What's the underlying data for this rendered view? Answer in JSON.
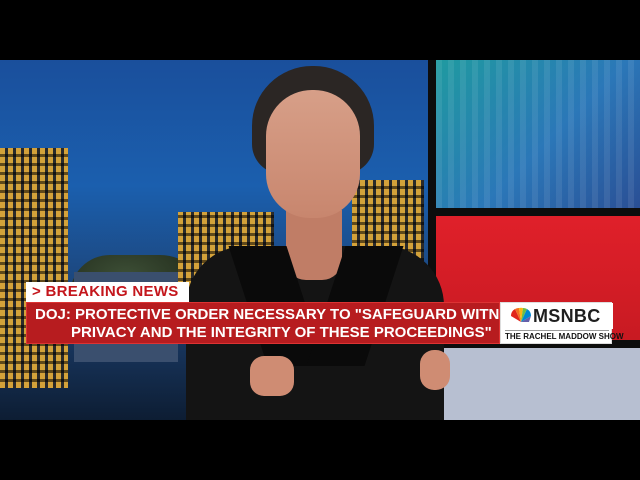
{
  "lower_third": {
    "breaking_label": "> BREAKING NEWS",
    "headline_line1": "DOJ: PROTECTIVE ORDER NECESSARY TO \"SAFEGUARD WITNESS",
    "headline_line2": "PRIVACY AND THE INTEGRITY OF THESE PROCEEDINGS\"",
    "colors": {
      "bar": "#b71c1f",
      "tag_text": "#c4161c"
    }
  },
  "branding": {
    "network": "MSNBC",
    "show": "THE RACHEL MADDOW SHOW",
    "logo_icon": "peacock-icon"
  }
}
